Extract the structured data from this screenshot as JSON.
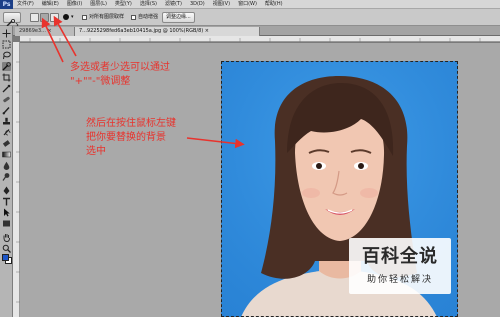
{
  "menubar": {
    "logo": "Ps",
    "items": [
      "文件(F)",
      "编辑(E)",
      "图像(I)",
      "图层(L)",
      "类型(Y)",
      "选择(S)",
      "滤镜(T)",
      "3D(D)",
      "视图(V)",
      "窗口(W)",
      "帮助(H)"
    ]
  },
  "options": {
    "sample_all_label": "对所有图层取样",
    "auto_enhance_label": "自动增强",
    "refine_edge_label": "调整边缘..."
  },
  "tabs": [
    {
      "label": "29869e3... × "
    },
    {
      "label": "7...9225298fed6a3eb10415a.jpg @ 100%(RGB/8) × "
    }
  ],
  "annotations": {
    "line1": "多选或者少选可以通过",
    "line2": "\"+\"\"-\"微调整",
    "line3": "然后在按住鼠标左键",
    "line4": "把你要替换的背景",
    "line5": "选中"
  },
  "watermark": {
    "title": "百科全说",
    "subtitle": "助你轻松解决"
  },
  "colors": {
    "annotation": "#e8332d",
    "photo_bg": "#2f8fe0",
    "foreground": "#1c56c9",
    "background": "#ffffff"
  },
  "icons": [
    "move-icon",
    "marquee-icon",
    "lasso-icon",
    "quick-selection-icon",
    "crop-icon",
    "eyedropper-icon",
    "healing-brush-icon",
    "brush-icon",
    "clone-stamp-icon",
    "history-brush-icon",
    "eraser-icon",
    "gradient-icon",
    "blur-icon",
    "dodge-icon",
    "pen-icon",
    "type-icon",
    "path-selection-icon",
    "shape-icon",
    "hand-icon",
    "zoom-icon"
  ]
}
